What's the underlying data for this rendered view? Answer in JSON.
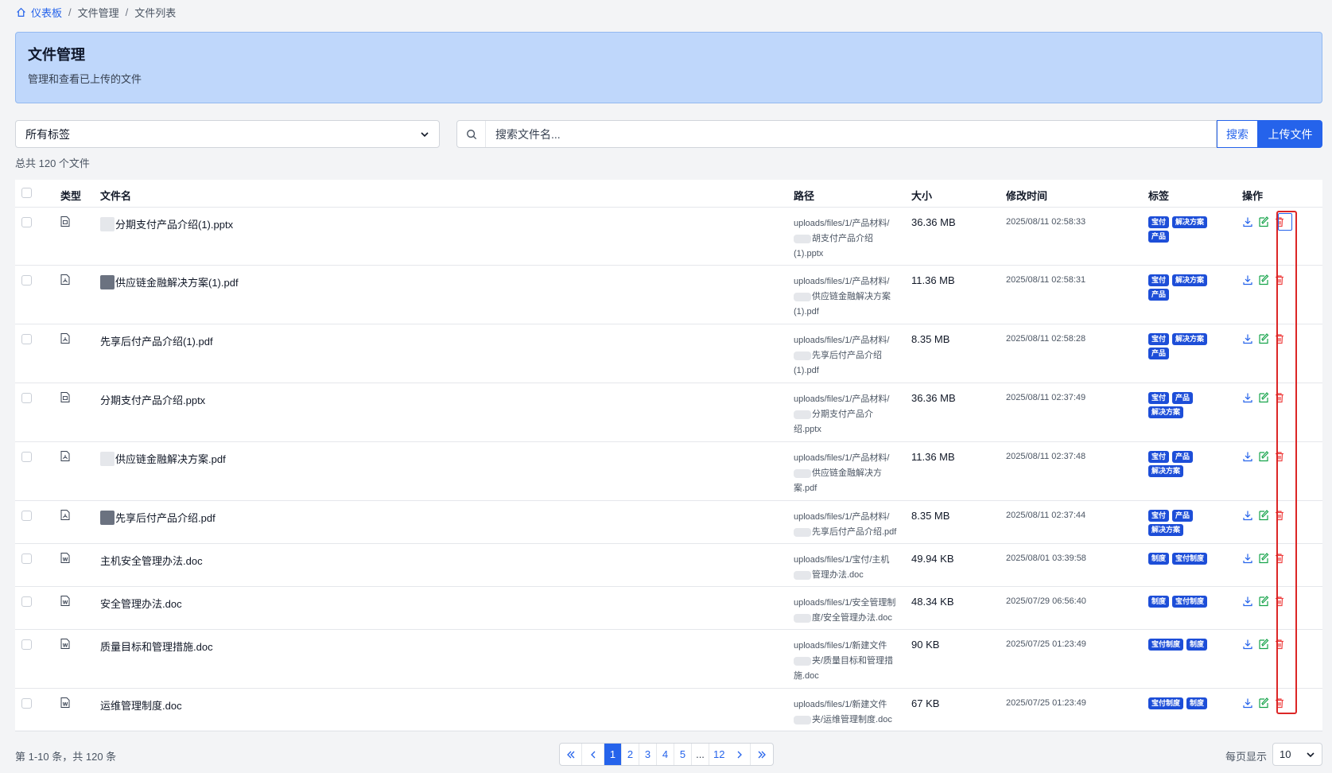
{
  "breadcrumb": {
    "home": "仪表板",
    "level2": "文件管理",
    "level3": "文件列表"
  },
  "banner": {
    "title": "文件管理",
    "subtitle": "管理和查看已上传的文件"
  },
  "filters": {
    "tag_select": "所有标签",
    "search_placeholder": "搜索文件名...",
    "search_label": "搜索",
    "upload_label": "上传文件"
  },
  "total_text": "总共 120 个文件",
  "columns": {
    "type": "类型",
    "name": "文件名",
    "path": "路径",
    "size": "大小",
    "modified": "修改时间",
    "tags": "标签",
    "actions": "操作"
  },
  "rows": [
    {
      "icon": "pptx",
      "name": "分期支付产品介绍(1).pptx",
      "redact": "light",
      "path1": "uploads/files/1/产品材料/",
      "path2": "胡支付产品介绍",
      "path3": "(1).pptx",
      "size": "36.36 MB",
      "time": "2025/08/11 02:58:33",
      "tags": [
        "宝付",
        "解决方案",
        "产品"
      ]
    },
    {
      "icon": "pdf",
      "name": "供应链金融解决方案(1).pdf",
      "redact": "dark",
      "path1": "uploads/files/1/产品材料/",
      "path2": "供应链金融解决方案",
      "path3": "(1).pdf",
      "size": "11.36 MB",
      "time": "2025/08/11 02:58:31",
      "tags": [
        "宝付",
        "解决方案",
        "产品"
      ]
    },
    {
      "icon": "pdf",
      "name": "先享后付产品介绍(1).pdf",
      "redact": "none",
      "path1": "uploads/files/1/产品材料/",
      "path2": "先享后付产品介绍",
      "path3": "(1).pdf",
      "size": "8.35 MB",
      "time": "2025/08/11 02:58:28",
      "tags": [
        "宝付",
        "解决方案",
        "产品"
      ]
    },
    {
      "icon": "pptx",
      "name": "分期支付产品介绍.pptx",
      "redact": "none",
      "path1": "uploads/files/1/产品材料/",
      "path2": "分期支付产品介",
      "path3": "绍.pptx",
      "size": "36.36 MB",
      "time": "2025/08/11 02:37:49",
      "tags": [
        "宝付",
        "产品",
        "解决方案"
      ]
    },
    {
      "icon": "pdf",
      "name": "供应链金融解决方案.pdf",
      "redact": "light",
      "path1": "uploads/files/1/产品材料/",
      "path2": "供应链金融解决方",
      "path3": "案.pdf",
      "size": "11.36 MB",
      "time": "2025/08/11 02:37:48",
      "tags": [
        "宝付",
        "产品",
        "解决方案"
      ]
    },
    {
      "icon": "pdf",
      "name": "先享后付产品介绍.pdf",
      "redact": "dark",
      "path1": "uploads/files/1/产品材料/",
      "path2": "先享后付产品介绍.pdf",
      "path3": "",
      "size": "8.35 MB",
      "time": "2025/08/11 02:37:44",
      "tags": [
        "宝付",
        "产品",
        "解决方案"
      ]
    },
    {
      "icon": "doc",
      "name": "主机安全管理办法.doc",
      "redact": "none",
      "path1": "uploads/files/1/宝付/主机",
      "path2": "管理办法.doc",
      "path3": "",
      "size": "49.94 KB",
      "time": "2025/08/01 03:39:58",
      "tags": [
        "制度",
        "宝付制度"
      ]
    },
    {
      "icon": "doc",
      "name": "安全管理办法.doc",
      "redact": "none",
      "path1": "uploads/files/1/安全管理制",
      "path2": "度/安全管理办法.doc",
      "path3": "",
      "size": "48.34 KB",
      "time": "2025/07/29 06:56:40",
      "tags": [
        "制度",
        "宝付制度"
      ]
    },
    {
      "icon": "doc",
      "name": "质量目标和管理措施.doc",
      "redact": "none",
      "path1": "uploads/files/1/新建文件",
      "path2": "夹/质量目标和管理措",
      "path3": "施.doc",
      "size": "90 KB",
      "time": "2025/07/25 01:23:49",
      "tags": [
        "宝付制度",
        "制度"
      ]
    },
    {
      "icon": "doc",
      "name": "运维管理制度.doc",
      "redact": "none",
      "path1": "uploads/files/1/新建文件",
      "path2": "夹/运维管理制度.doc",
      "path3": "",
      "size": "67 KB",
      "time": "2025/07/25 01:23:49",
      "tags": [
        "宝付制度",
        "制度"
      ]
    }
  ],
  "pagination": {
    "range_text": "第 1-10 条，共 120 条",
    "pages": [
      "1",
      "2",
      "3",
      "4",
      "5",
      "...",
      "12"
    ],
    "current": "1",
    "per_page_label": "每页显示",
    "per_page": "10"
  },
  "colors": {
    "primary": "#2563eb",
    "banner": "#bfd7fb",
    "tag": "#1d4ed8",
    "delete": "#ef4444",
    "edit": "#16a34a",
    "highlight": "#dc2626"
  }
}
